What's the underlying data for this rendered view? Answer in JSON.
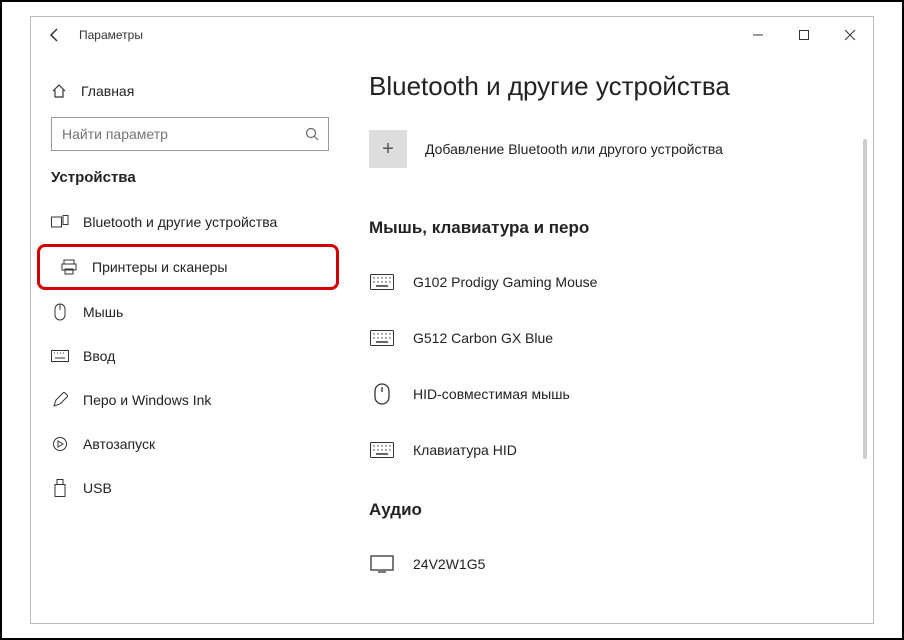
{
  "window": {
    "title": "Параметры"
  },
  "sidebar": {
    "home": "Главная",
    "search_placeholder": "Найти параметр",
    "section": "Устройства",
    "items": [
      {
        "label": "Bluetooth и другие устройства"
      },
      {
        "label": "Принтеры и сканеры"
      },
      {
        "label": "Мышь"
      },
      {
        "label": "Ввод"
      },
      {
        "label": "Перо и Windows Ink"
      },
      {
        "label": "Автозапуск"
      },
      {
        "label": "USB"
      }
    ]
  },
  "main": {
    "title": "Bluetooth и другие устройства",
    "add_label": "Добавление Bluetooth или другого устройства",
    "section1": "Мышь, клавиатура и перо",
    "devices": [
      {
        "label": "G102 Prodigy Gaming Mouse"
      },
      {
        "label": "G512 Carbon GX Blue"
      },
      {
        "label": "HID-совместимая мышь"
      },
      {
        "label": "Клавиатура HID"
      }
    ],
    "section2": "Аудио",
    "audio_devices": [
      {
        "label": "24V2W1G5"
      }
    ]
  }
}
